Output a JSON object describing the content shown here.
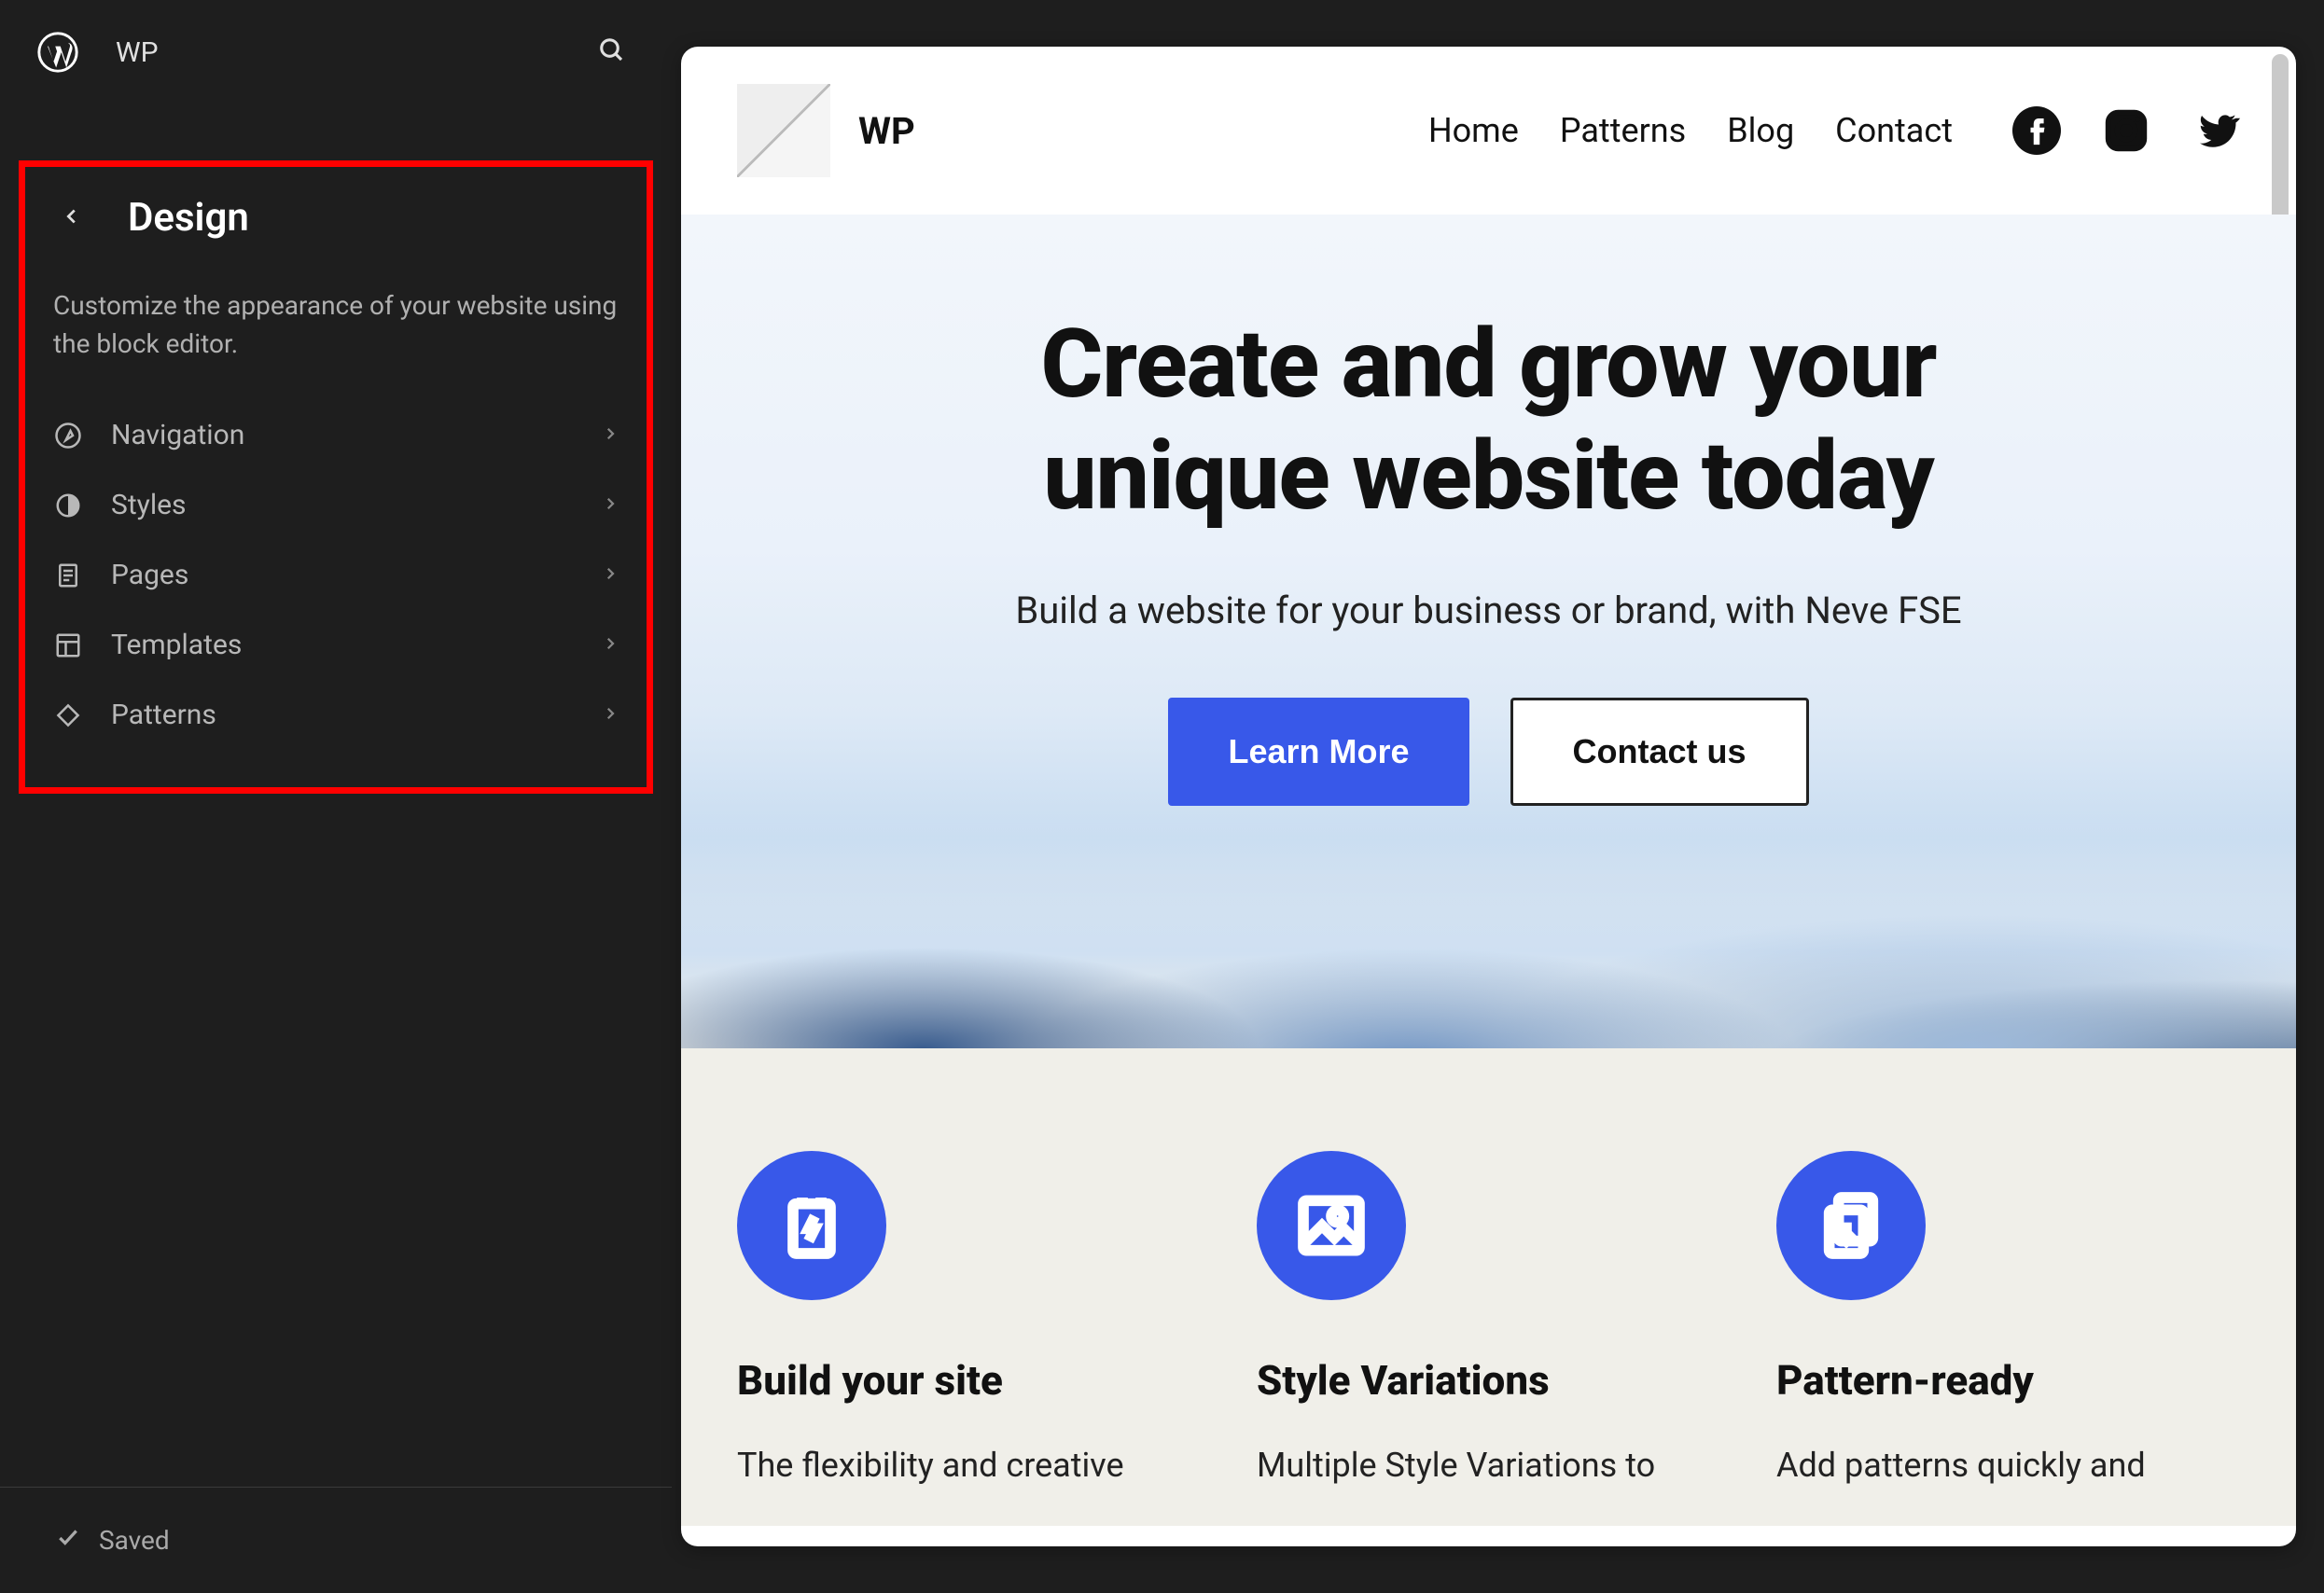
{
  "topbar": {
    "site_name": "WP"
  },
  "sidebar": {
    "title": "Design",
    "description": "Customize the appearance of your website using the block editor.",
    "items": [
      {
        "label": "Navigation",
        "icon": "compass-icon"
      },
      {
        "label": "Styles",
        "icon": "half-circle-icon"
      },
      {
        "label": "Pages",
        "icon": "page-icon"
      },
      {
        "label": "Templates",
        "icon": "layout-icon"
      },
      {
        "label": "Patterns",
        "icon": "diamond-icon"
      }
    ],
    "saved_label": "Saved"
  },
  "preview": {
    "header": {
      "site_title": "WP",
      "nav": [
        "Home",
        "Patterns",
        "Blog",
        "Contact"
      ],
      "social": [
        "facebook",
        "instagram",
        "twitter"
      ]
    },
    "hero": {
      "heading_line1": "Create and grow your",
      "heading_line2": "unique website today",
      "subheading": "Build a website for your business or brand, with Neve FSE",
      "cta_primary": "Learn More",
      "cta_secondary": "Contact us"
    },
    "features": [
      {
        "title": "Build your site",
        "desc": "The flexibility and creative",
        "icon": "battery-icon"
      },
      {
        "title": "Style Variations",
        "desc": "Multiple Style Variations to",
        "icon": "image-icon"
      },
      {
        "title": "Pattern-ready",
        "desc": "Add patterns quickly and",
        "icon": "download-doc-icon"
      }
    ]
  }
}
